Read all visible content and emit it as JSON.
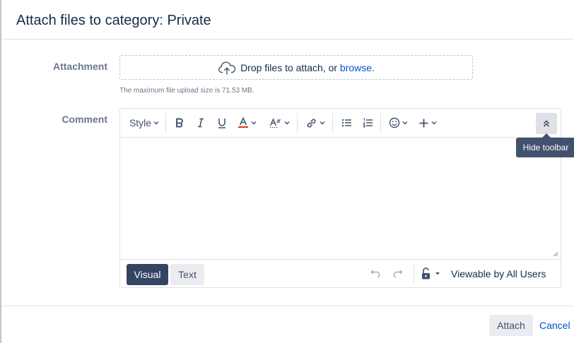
{
  "dialog": {
    "title": "Attach files to category: Private"
  },
  "attachment": {
    "label": "Attachment",
    "drop_text": "Drop files to attach, or",
    "browse_text": "browse.",
    "hint": "The maximum file upload size is 71.53 MB."
  },
  "comment": {
    "label": "Comment",
    "toolbar": {
      "style_label": "Style",
      "icons": [
        "bold-icon",
        "italic-icon",
        "underline-icon",
        "text-color-icon",
        "text-format-icon",
        "link-icon",
        "bullet-list-icon",
        "numbered-list-icon",
        "emoji-icon",
        "insert-plus-icon",
        "collapse-toolbar-icon"
      ],
      "text_color": "#de350b",
      "hide_tooltip": "Hide toolbar"
    },
    "footer": {
      "visual_label": "Visual",
      "text_label": "Text",
      "viewable_label": "Viewable by All Users"
    }
  },
  "actions": {
    "attach_label": "Attach",
    "cancel_label": "Cancel"
  }
}
